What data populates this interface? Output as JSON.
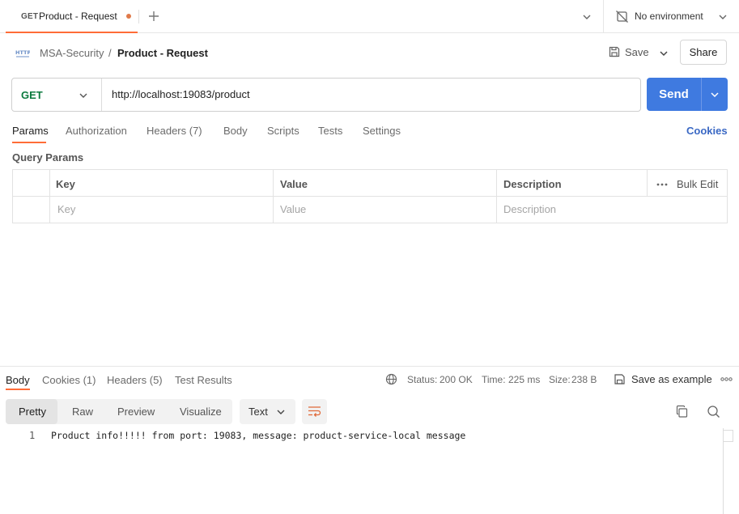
{
  "tab": {
    "method": "GET",
    "name": "Product - Request"
  },
  "environment": {
    "label": "No environment"
  },
  "breadcrumb": {
    "collection": "MSA-Security",
    "separator": "/",
    "request": "Product - Request"
  },
  "actions": {
    "save": "Save",
    "share": "Share"
  },
  "request": {
    "method": "GET",
    "url": "http://localhost:19083/product",
    "send": "Send"
  },
  "request_tabs": {
    "params": "Params",
    "authorization": "Authorization",
    "headers": "Headers (7)",
    "body": "Body",
    "scripts": "Scripts",
    "tests": "Tests",
    "settings": "Settings",
    "cookies": "Cookies"
  },
  "query_params": {
    "title": "Query Params",
    "columns": {
      "key": "Key",
      "value": "Value",
      "description": "Description"
    },
    "bulk_edit": "Bulk Edit",
    "placeholder": {
      "key": "Key",
      "value": "Value",
      "description": "Description"
    }
  },
  "response": {
    "tabs": {
      "body": "Body",
      "cookies": "Cookies (1)",
      "headers": "Headers (5)",
      "test_results": "Test Results"
    },
    "status_label": "Status:",
    "status_value": "200 OK",
    "time_label": "Time:",
    "time_value": "225 ms",
    "size_label": "Size:",
    "size_value": "238 B",
    "save_as_example": "Save as example",
    "format_modes": {
      "pretty": "Pretty",
      "raw": "Raw",
      "preview": "Preview",
      "visualize": "Visualize"
    },
    "type": "Text",
    "lines": [
      {
        "number": "1",
        "text": "Product info!!!!! from port: 19083, message: product-service-local message"
      }
    ]
  },
  "colors": {
    "accent": "#ff6c37",
    "send_button": "#3f7ae0",
    "get_method": "#0b7a3e",
    "link": "#3a68c4"
  }
}
